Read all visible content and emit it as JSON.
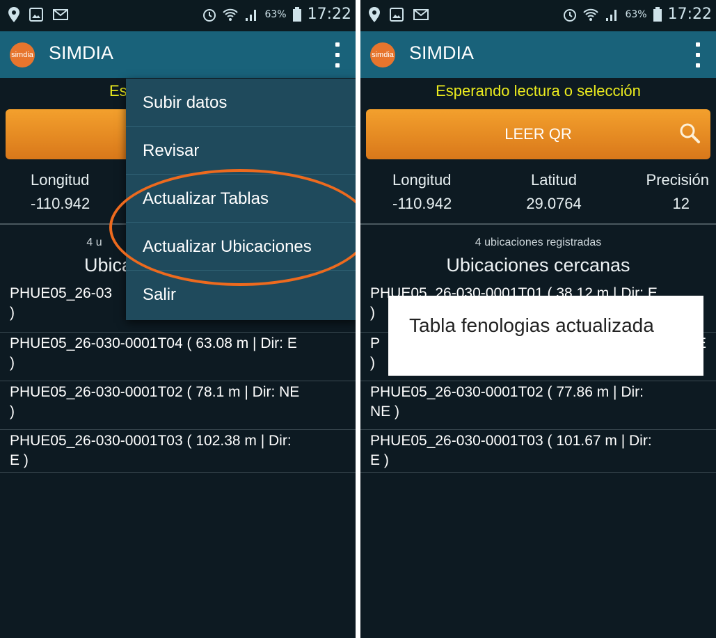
{
  "status_bar": {
    "battery_pct": "63%",
    "time": "17:22"
  },
  "app": {
    "logo_text": "simdia",
    "title": "SIMDIA"
  },
  "left": {
    "status_text": "Esperar",
    "coords": {
      "longitud_label": "Longitud",
      "longitud_value": "-110.942"
    },
    "count_text": "4 u",
    "section_title": "Ubica",
    "locations": [
      "PHUE05_26-03",
      ")",
      "PHUE05_26-030-0001T04 ( 63.08 m | Dir: E",
      ")",
      "PHUE05_26-030-0001T02 ( 78.1 m | Dir: NE",
      ")",
      "PHUE05_26-030-0001T03 ( 102.38 m | Dir:",
      "E )"
    ],
    "menu": [
      "Subir datos",
      "Revisar",
      "Actualizar Tablas",
      "Actualizar Ubicaciones",
      "Salir"
    ]
  },
  "right": {
    "status_text": "Esperando lectura o selección",
    "qr_button": "LEER QR",
    "coords": {
      "longitud_label": "Longitud",
      "longitud_value": "-110.942",
      "latitud_label": "Latitud",
      "latitud_value": "29.0764",
      "precision_label": "Precisión",
      "precision_value": "12"
    },
    "count_text": "4 ubicaciones registradas",
    "section_title": "Ubicaciones cercanas",
    "locations": [
      "PHUE05_26-030-0001T01 ( 38.12 m | Dir: E",
      ")",
      "P",
      "E",
      ")",
      "PHUE05_26-030-0001T02 ( 77.86 m | Dir:",
      "NE )",
      "PHUE05_26-030-0001T03 ( 101.67 m | Dir:",
      "E )"
    ],
    "toast": "Tabla fenologias actualizada"
  },
  "colors": {
    "appbar": "#19627a",
    "status_text": "#ecec1e",
    "qr_button": "#e88c24",
    "menu_bg": "#1f4a5c",
    "highlight": "#ed6a1e",
    "background": "#0d1a22"
  }
}
